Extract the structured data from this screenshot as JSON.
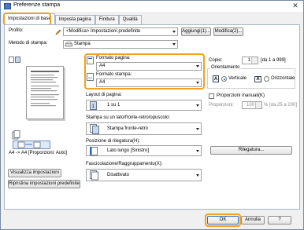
{
  "window": {
    "title": "Preferenze stampa",
    "close_glyph": "✕"
  },
  "tabs": [
    "Impostazioni di base",
    "Imposta pagina",
    "Finitura",
    "Qualità"
  ],
  "profile": {
    "label": "Profilo:",
    "value": "<Modifica> Impostazioni predefinite",
    "add_button": "Aggiungi(1)...",
    "edit_button": "Modifica(2)..."
  },
  "output_method": {
    "label": "Metodo di stampa:",
    "value": "Stampa"
  },
  "preview_caption": "A4 -> A4 [Proporzioni: Auto]",
  "view_settings_button": "Visualizza impostazioni",
  "restore_defaults_button": "Ripristina impostazioni predefinite",
  "page_size": {
    "label": "Formato pagina:",
    "value": "A4"
  },
  "output_size": {
    "label": "Formato stampa:",
    "value": "A4"
  },
  "copies": {
    "label": "Copie:",
    "value": "1",
    "range": "[da 1 a 999]"
  },
  "orientation": {
    "label": "Orientamento",
    "portrait": "Verticale",
    "landscape": "Orizzontale",
    "icon_letter": "A",
    "selected": "Verticale"
  },
  "page_layout": {
    "label": "Layout di pagina:",
    "value": "1 su 1"
  },
  "manual_scaling": {
    "label": "Proporzioni manuali(K)",
    "sublabel": "Proporzioni:",
    "value": "100",
    "range": "% [da 25 a 200]"
  },
  "duplex": {
    "label": "Stampa su un lato/fronte-retro/opuscolo:",
    "value": "Stampa fronte-retro"
  },
  "binding": {
    "label": "Posizione di rilegatura(H):",
    "value": "Lato lungo [Sinistro]",
    "button": "Rilegatura..."
  },
  "collate": {
    "label": "Fascicolazione/Raggruppamento(X):",
    "value": "Disattivato"
  },
  "footer": {
    "ok": "OK",
    "cancel": "Annulla",
    "help": "?"
  },
  "colors": {
    "highlight": "#f2a020",
    "accent": "#1a5bc4"
  }
}
